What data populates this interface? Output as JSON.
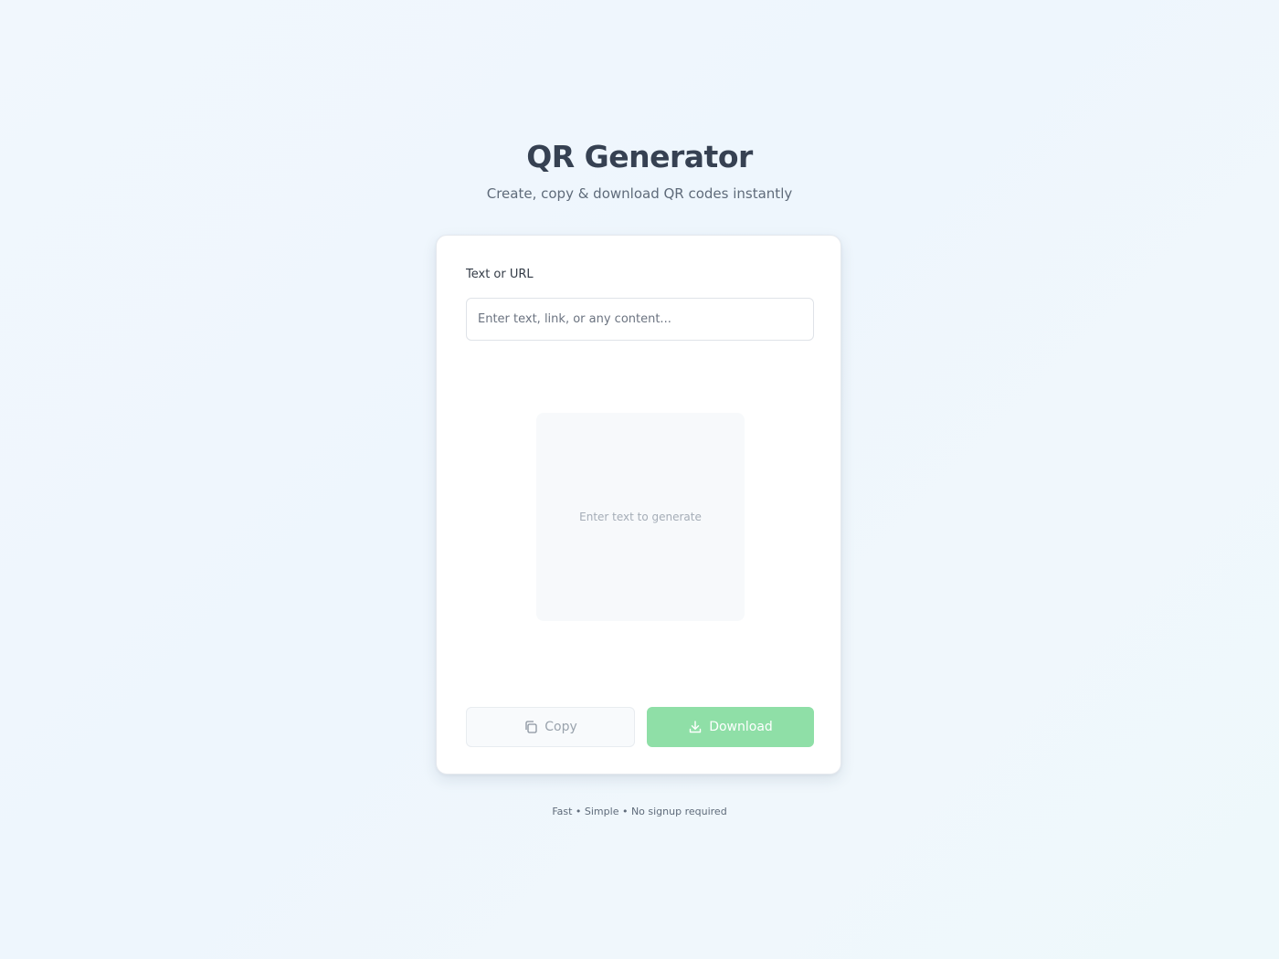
{
  "header": {
    "title": "QR Generator",
    "subtitle": "Create, copy & download QR codes instantly"
  },
  "form": {
    "label": "Text or URL",
    "input_value": "",
    "input_placeholder": "Enter text, link, or any content..."
  },
  "preview": {
    "placeholder": "Enter text to generate"
  },
  "actions": {
    "copy_label": "Copy",
    "copy_icon": "copy-icon",
    "download_label": "Download",
    "download_icon": "download-icon"
  },
  "footer": {
    "tagline": "Fast • Simple • No signup required"
  },
  "colors": {
    "accent_green": "#8fdfa7",
    "title": "#364152",
    "background": "#eef6fd"
  }
}
